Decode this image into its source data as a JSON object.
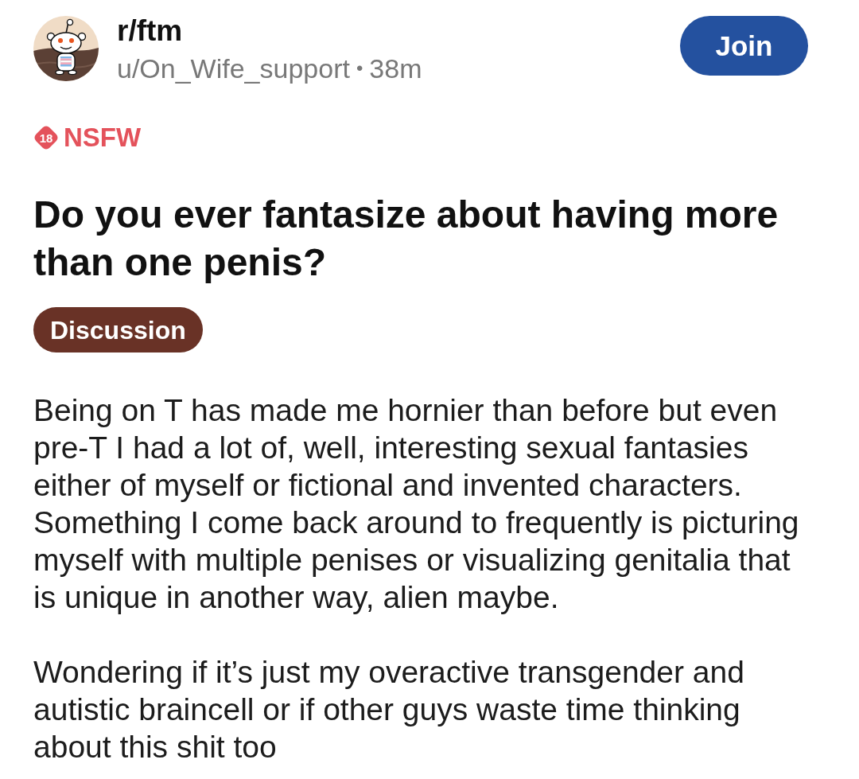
{
  "post": {
    "community": "r/ftm",
    "author": "u/On_Wife_support",
    "separator": "•",
    "age": "38m",
    "join_button": "Join",
    "nsfw": {
      "badge": "18",
      "label": "NSFW"
    },
    "title": "Do you ever fantasize about having more than one penis?",
    "flair": "Discussion",
    "body": [
      "Being on T has made me hornier than before but even pre-T I had a lot of, well, interesting sexual fantasies either of myself or fictional and invented characters. Something I come back around to frequently is picturing myself with multiple penises or visualizing genitalia that is unique in another way, alien maybe.",
      "Wondering if it’s just my overactive transgender and autistic braincell or if other guys waste time thinking about this shit too"
    ]
  }
}
